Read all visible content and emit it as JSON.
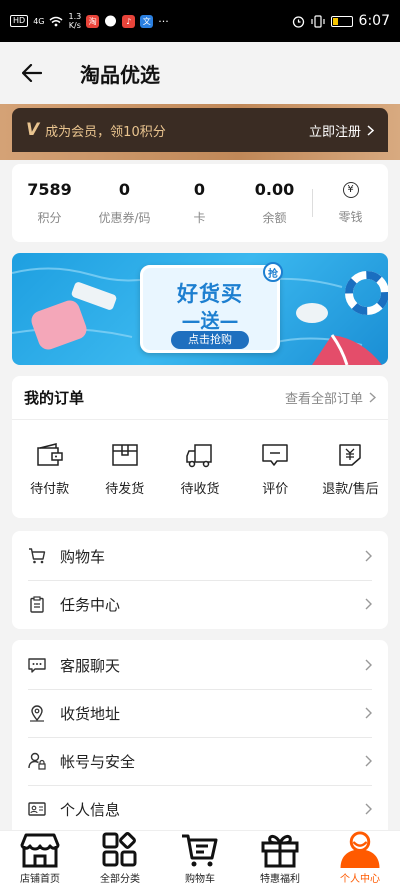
{
  "status_bar": {
    "network_chip": "HD",
    "signal": "4G",
    "speed_value": "1.3",
    "speed_unit": "K/s",
    "time": "6:07",
    "app_badge_1": "淘",
    "app_badge_2": "文"
  },
  "header": {
    "title": "淘品优选"
  },
  "member": {
    "badge": "V",
    "text": "成为会员，领10积分",
    "register_label": "立即注册"
  },
  "stats": [
    {
      "value": "7589",
      "label": "积分"
    },
    {
      "value": "0",
      "label": "优惠券/码"
    },
    {
      "value": "0",
      "label": "卡"
    },
    {
      "value": "0.00",
      "label": "余额"
    }
  ],
  "change": {
    "symbol": "¥",
    "label": "零钱"
  },
  "promo": {
    "title": "好货买",
    "line2": "—送—",
    "cta": "点击抢购",
    "badge": "抢"
  },
  "orders": {
    "title": "我的订单",
    "view_all": "查看全部订单",
    "items": [
      {
        "label": "待付款",
        "icon": "wallet-icon"
      },
      {
        "label": "待发货",
        "icon": "box-icon"
      },
      {
        "label": "待收货",
        "icon": "truck-icon"
      },
      {
        "label": "评价",
        "icon": "comment-icon"
      },
      {
        "label": "退款/售后",
        "icon": "refund-icon"
      }
    ]
  },
  "group1": [
    {
      "label": "购物车",
      "icon": "cart-icon"
    },
    {
      "label": "任务中心",
      "icon": "clipboard-icon"
    }
  ],
  "group2": [
    {
      "label": "客服聊天",
      "icon": "chat-icon"
    },
    {
      "label": "收货地址",
      "icon": "location-icon"
    },
    {
      "label": "帐号与安全",
      "icon": "account-security-icon"
    },
    {
      "label": "个人信息",
      "icon": "id-card-icon"
    }
  ],
  "nav": [
    {
      "label": "店铺首页",
      "icon": "store-icon"
    },
    {
      "label": "全部分类",
      "icon": "category-icon"
    },
    {
      "label": "购物车",
      "icon": "cart-icon"
    },
    {
      "label": "特惠福利",
      "icon": "gift-icon"
    },
    {
      "label": "个人中心",
      "icon": "profile-icon",
      "active": true
    }
  ],
  "colors": {
    "accent": "#ff5a00",
    "member_bg": "#3a2c23",
    "member_text": "#e9c48f",
    "promo_blue": "#1d7fd0"
  }
}
